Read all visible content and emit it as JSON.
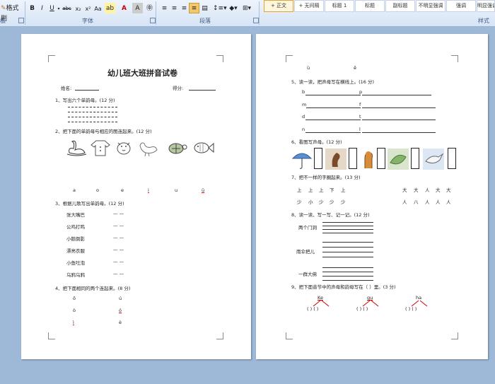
{
  "ribbon": {
    "format_painter": "格式刷",
    "groups": {
      "clipboard": "板",
      "font": "字体",
      "paragraph": "段落",
      "styles": "样式"
    },
    "styles": [
      "+ 正文",
      "+ 无间隔",
      "标题 1",
      "标题",
      "副标题",
      "不明显强调",
      "强调",
      "明显强调"
    ]
  },
  "page1": {
    "title": "幼儿班大班拼音试卷",
    "name_label": "姓名:",
    "score_label": "得分:",
    "q1": "1、写出六个单韵母。(12 分)",
    "q2": "2、把下面的单韵母与相应的图连起来。(12 分)",
    "q2_vowels": [
      "a",
      "o",
      "e",
      "i",
      "u",
      "ü"
    ],
    "q3": "3、根据儿歌写出单韵母。(12 分)",
    "q3_items": [
      {
        "text": "张大嘴巴",
        "blank": "— —"
      },
      {
        "text": "公鸡打鸣",
        "blank": "— —"
      },
      {
        "text": "小鹅倒影",
        "blank": "— —"
      },
      {
        "text": "漂亮衣服",
        "blank": "— —"
      },
      {
        "text": "小鱼吐泡",
        "blank": "— —"
      },
      {
        "text": "乌鸦乌鸦",
        "blank": "— —"
      }
    ],
    "q4": "4、把下面相同的两个连起来。(8 分)",
    "q4_left": [
      "ō",
      "ò",
      "ì"
    ],
    "q4_right": [
      "ú",
      "ó",
      "è"
    ]
  },
  "page2": {
    "top_letters": [
      "ù",
      "ē"
    ],
    "q5": "5、读一读，把声母写在横线上。(16 分)",
    "q5_rows": [
      {
        "left": "b",
        "right": "p"
      },
      {
        "left": "m",
        "right": "f"
      },
      {
        "left": "d",
        "right": "t"
      },
      {
        "left": "n",
        "right": "l"
      }
    ],
    "q6": "6、看图写声母。(12 分)",
    "q7": "7、把不一样的字圈起来。(13 分)",
    "q7_row1_left": [
      "上",
      "上",
      "上",
      "下",
      "上"
    ],
    "q7_row1_right": [
      "大",
      "大",
      "人",
      "大",
      "大"
    ],
    "q7_row2_left": [
      "少",
      "小",
      "少",
      "少",
      "少"
    ],
    "q7_row2_right": [
      "人",
      "八",
      "人",
      "人",
      "人"
    ],
    "q8": "8、读一读、写一写、记一记。(12 分)",
    "q8_words": [
      "两个门洞",
      "雨伞把儿",
      "一群大佛"
    ],
    "q9": "9、把下面音节中的声母和韵母写在（ ）里。(3 分)",
    "q9_syllables": [
      "Ke",
      "gu",
      "ha"
    ],
    "q9_paren": "(   )   (   )"
  }
}
